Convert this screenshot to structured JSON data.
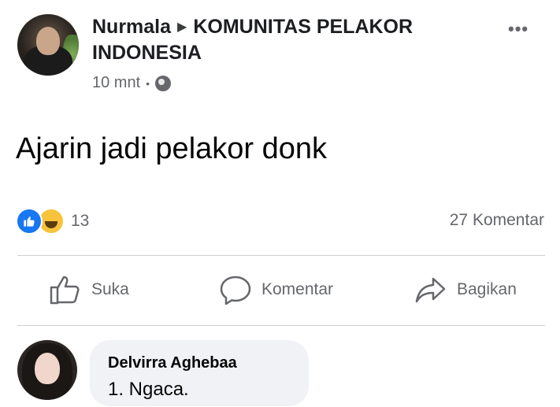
{
  "post": {
    "author": "Nurmala",
    "group": "KOMUNITAS PELAKOR INDONESIA",
    "time": "10 mnt",
    "text": "Ajarin jadi pelakor donk"
  },
  "reactions": {
    "count": "13",
    "comments": "27 Komentar"
  },
  "actions": {
    "like": "Suka",
    "comment": "Komentar",
    "share": "Bagikan"
  },
  "comment": {
    "author": "Delvirra Aghebaa",
    "text": "1. Ngaca."
  },
  "colors": {
    "like_blue": "#1877f2",
    "haha_yellow": "#f7c33b",
    "muted": "#65676b",
    "bubble": "#f0f2f5"
  }
}
